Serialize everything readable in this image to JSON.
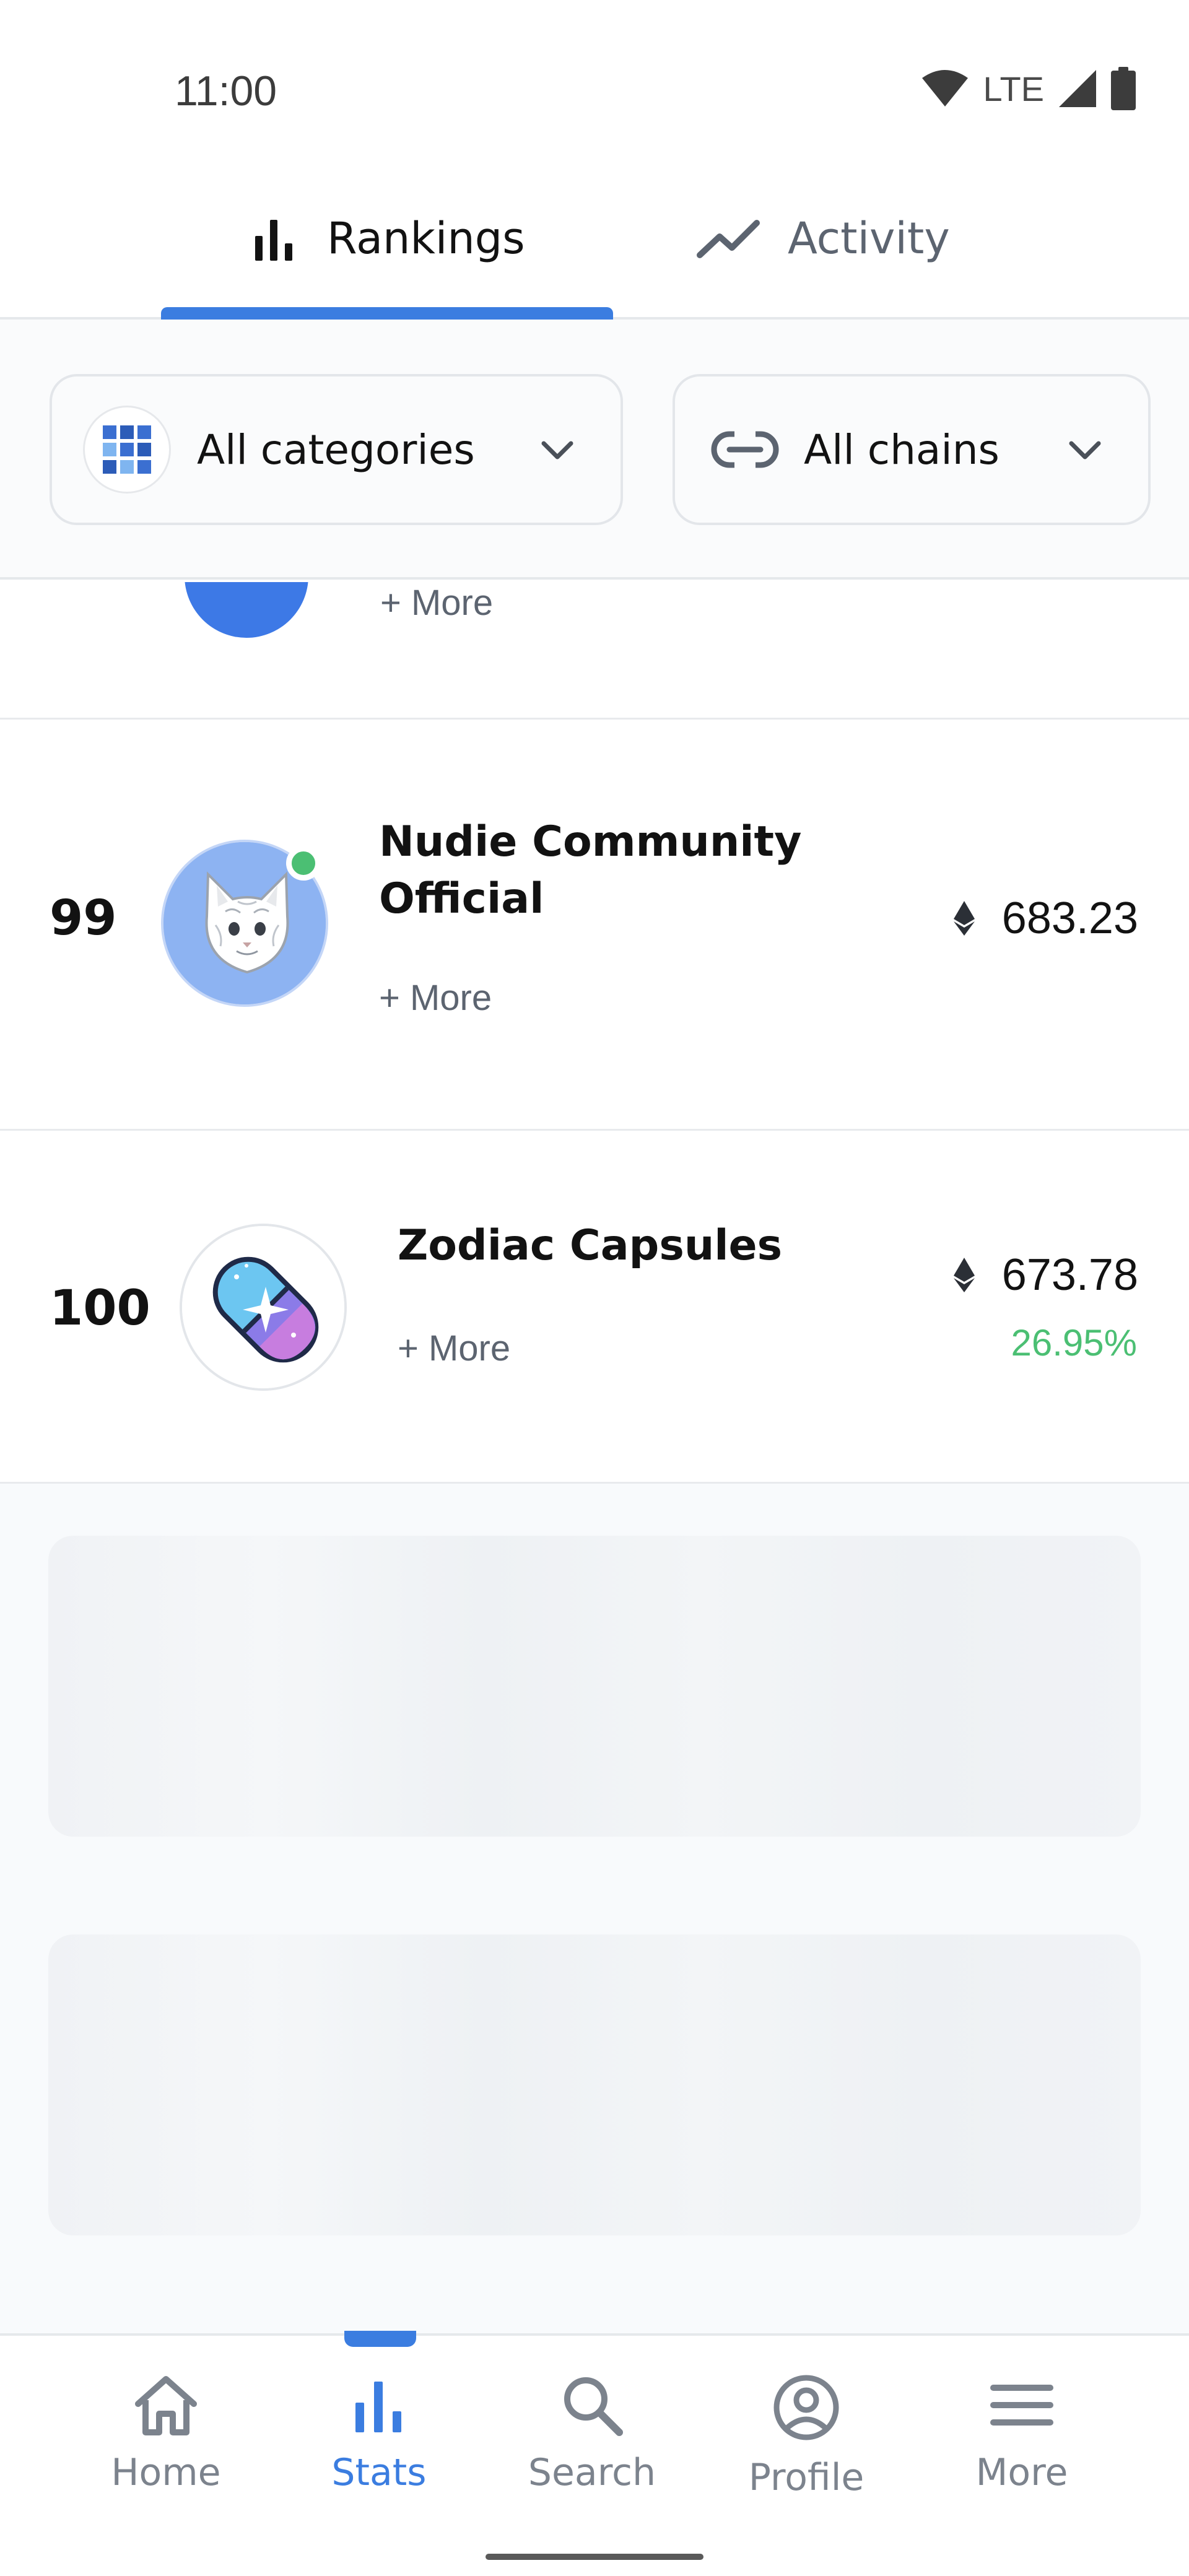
{
  "status_bar": {
    "time": "11:00",
    "network": "LTE",
    "icons": [
      "wifi-icon",
      "signal-icon",
      "battery-icon"
    ]
  },
  "tabs": [
    {
      "label": "Rankings",
      "icon": "bar-chart-icon",
      "active": true
    },
    {
      "label": "Activity",
      "icon": "trend-line-icon",
      "active": false
    }
  ],
  "filters": {
    "categories_label": "All categories",
    "chains_label": "All chains"
  },
  "rows": {
    "partial": {
      "more_label": "+ More"
    },
    "item_99": {
      "rank": "99",
      "name": "Nudie Community Official",
      "more_label": "+ More",
      "value": "683.23",
      "currency_icon": "ethereum-icon",
      "online": true
    },
    "item_100": {
      "rank": "100",
      "name": "Zodiac Capsules",
      "more_label": "+ More",
      "value": "673.78",
      "change": "26.95%",
      "currency_icon": "ethereum-icon"
    }
  },
  "bottom_nav": [
    {
      "label": "Home",
      "icon": "home-icon",
      "active": false
    },
    {
      "label": "Stats",
      "icon": "bar-chart-icon",
      "active": true
    },
    {
      "label": "Search",
      "icon": "search-icon",
      "active": false
    },
    {
      "label": "Profile",
      "icon": "profile-icon",
      "active": false
    },
    {
      "label": "More",
      "icon": "menu-icon",
      "active": false
    }
  ],
  "colors": {
    "accent": "#3b7de0",
    "positive": "#4bbf73",
    "muted_text": "#5c6470"
  }
}
